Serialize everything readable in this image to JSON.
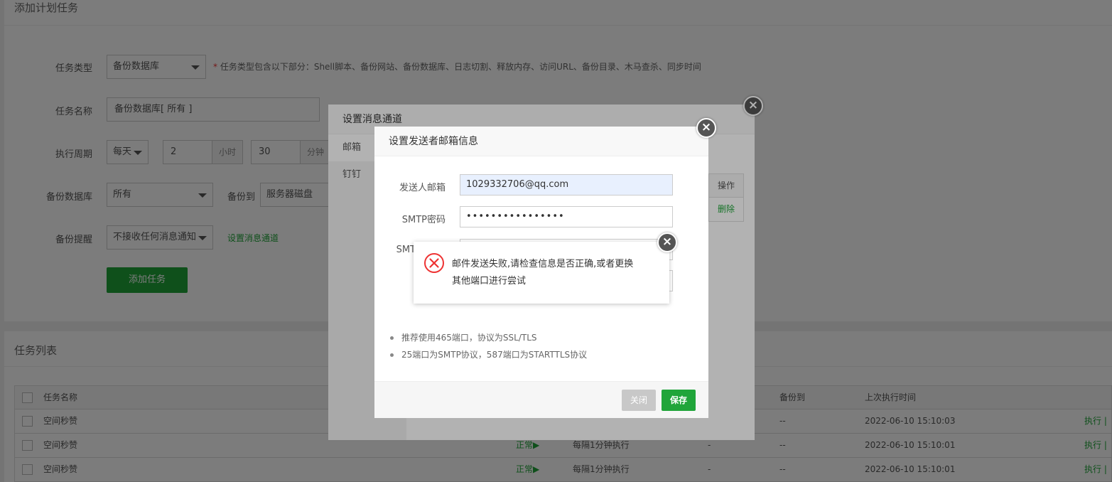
{
  "add_task": {
    "title": "添加计划任务",
    "task_type": {
      "label": "任务类型",
      "value": "备份数据库",
      "hint_star": "*",
      "hint": "任务类型包含以下部分：Shell脚本、备份网站、备份数据库、日志切割、释放内存、访问URL、备份目录、木马查杀、同步时间"
    },
    "task_name": {
      "label": "任务名称",
      "value": "备份数据库[ 所有 ]"
    },
    "cycle": {
      "label": "执行周期",
      "period": "每天",
      "hour": "2",
      "hour_unit": "小时",
      "minute": "30",
      "minute_unit": "分钟"
    },
    "database": {
      "label": "备份数据库",
      "value": "所有",
      "backup_to_label": "备份到",
      "backup_to": "服务器磁盘"
    },
    "remind": {
      "label": "备份提醒",
      "value": "不接收任何消息通知",
      "link": "设置消息通道"
    },
    "submit": "添加任务"
  },
  "task_list": {
    "title": "任务列表",
    "headers": {
      "name": "任务名称",
      "backup_to": "备份到",
      "last_run": "上次执行时间"
    },
    "rows": [
      {
        "name": "空间秒赞",
        "status": "",
        "cycle": "",
        "dash": "",
        "backup_to": "--",
        "last_run": "2022-06-10 15:10:03",
        "action": "执行 |"
      },
      {
        "name": "空间秒赞",
        "status": "正常▶",
        "cycle": "每隔1分钟执行",
        "dash": "-",
        "backup_to": "--",
        "last_run": "2022-06-10 15:10:01",
        "action": "执行 |"
      },
      {
        "name": "空间秒赞",
        "status": "正常▶",
        "cycle": "每隔1分钟执行",
        "dash": "-",
        "backup_to": "--",
        "last_run": "2022-06-10 15:10:01",
        "action": "执行 |"
      }
    ]
  },
  "channel_dialog": {
    "title": "设置消息通道",
    "tabs": [
      "邮箱",
      "钉钉"
    ],
    "table_header": "操作",
    "table_action": "删除"
  },
  "email_dialog": {
    "title": "设置发送者邮箱信息",
    "sender_label": "发送人邮箱",
    "sender_value": "1029332706@qq.com",
    "smtp_pwd_label": "SMTP密码",
    "smtp_pwd_value": "••••••••••••••••",
    "smtp_partial_label": "SMT",
    "tips": [
      "推荐使用465端口，协议为SSL/TLS",
      "25端口为SMTP协议，587端口为STARTTLS协议"
    ],
    "close_btn": "关闭",
    "save_btn": "保存"
  },
  "error_dialog": {
    "line1": "邮件发送失败,请检查信息是否正确,或者更换",
    "line2": "其他端口进行尝试"
  },
  "colors": {
    "accent": "#20a53a",
    "error": "#e33"
  },
  "icons": {
    "close": "close-icon",
    "error": "error-circle-icon",
    "caret": "caret-down-icon"
  }
}
